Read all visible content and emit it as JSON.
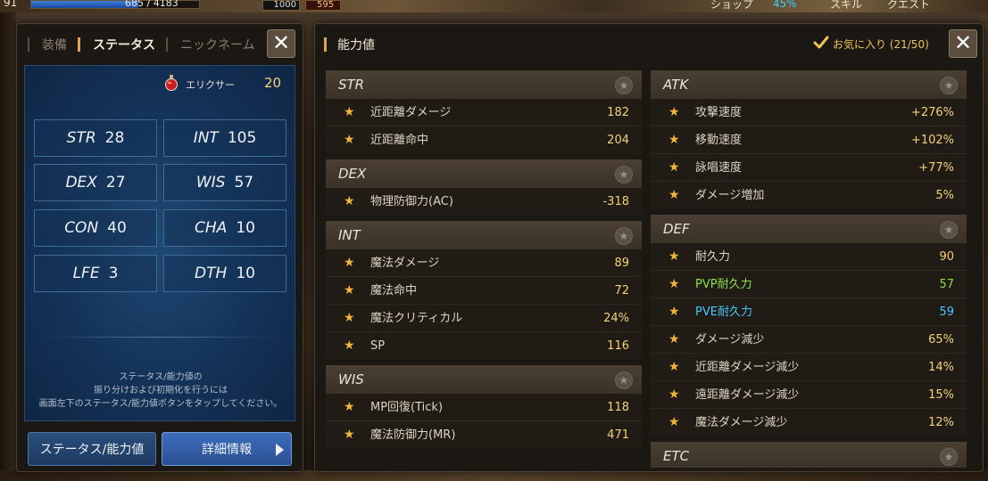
{
  "hud": {
    "level": "91",
    "hp_text": "685 / 4183",
    "hp_fraction": 0.64,
    "box1": "1000",
    "box2": "595",
    "menu": [
      "ショップ",
      "スキル",
      "クエスト"
    ],
    "percent": "45%"
  },
  "status_panel": {
    "tabs": [
      "装備",
      "ステータス",
      "ニックネーム"
    ],
    "active_tab": 1,
    "elixir": {
      "label": "エリクサー",
      "count": "20"
    },
    "stats": [
      {
        "name": "STR",
        "value": "28"
      },
      {
        "name": "INT",
        "value": "105"
      },
      {
        "name": "DEX",
        "value": "27"
      },
      {
        "name": "WIS",
        "value": "57"
      },
      {
        "name": "CON",
        "value": "40"
      },
      {
        "name": "CHA",
        "value": "10"
      },
      {
        "name": "LFE",
        "value": "3"
      },
      {
        "name": "DTH",
        "value": "10"
      }
    ],
    "hint_lines": [
      "ステータス/能力値の",
      "振り分けおよび初期化を行うには",
      "画面左下のステータス/能力値ボタンをタップしてください。"
    ],
    "buttons": {
      "status": "ステータス/能力値",
      "detail": "詳細情報"
    }
  },
  "ability_panel": {
    "title": "能力値",
    "favorite_label": "お気に入り (21/50)",
    "left_sections": [
      {
        "title": "STR",
        "rows": [
          {
            "label": "近距離ダメージ",
            "value": "182"
          },
          {
            "label": "近距離命中",
            "value": "204"
          }
        ]
      },
      {
        "title": "DEX",
        "rows": [
          {
            "label": "物理防御力(AC)",
            "value": "-318"
          }
        ]
      },
      {
        "title": "INT",
        "rows": [
          {
            "label": "魔法ダメージ",
            "value": "89"
          },
          {
            "label": "魔法命中",
            "value": "72"
          },
          {
            "label": "魔法クリティカル",
            "value": "24%"
          },
          {
            "label": "SP",
            "value": "116"
          }
        ]
      },
      {
        "title": "WIS",
        "rows": [
          {
            "label": "MP回復(Tick)",
            "value": "118"
          },
          {
            "label": "魔法防御力(MR)",
            "value": "471"
          }
        ]
      }
    ],
    "right_sections": [
      {
        "title": "ATK",
        "rows": [
          {
            "label": "攻撃速度",
            "value": "+276%"
          },
          {
            "label": "移動速度",
            "value": "+102%"
          },
          {
            "label": "詠唱速度",
            "value": "+77%"
          },
          {
            "label": "ダメージ増加",
            "value": "5%"
          }
        ]
      },
      {
        "title": "DEF",
        "rows": [
          {
            "label": "耐久力",
            "value": "90"
          },
          {
            "label": "PVP耐久力",
            "value": "57",
            "color": "green"
          },
          {
            "label": "PVE耐久力",
            "value": "59",
            "color": "cyan"
          },
          {
            "label": "ダメージ減少",
            "value": "65%"
          },
          {
            "label": "近距離ダメージ減少",
            "value": "14%"
          },
          {
            "label": "遠距離ダメージ減少",
            "value": "15%"
          },
          {
            "label": "魔法ダメージ減少",
            "value": "12%"
          }
        ]
      },
      {
        "title": "ETC",
        "rows": []
      }
    ]
  },
  "colors": {
    "accent_gold": "#f3d27a",
    "star": "#f1b53a",
    "pvp_green": "#8fe04c",
    "pve_cyan": "#45c8ff",
    "status_blue": "#143258"
  },
  "icons": {
    "row_marker": "star-icon",
    "section_favorite": "star-circle-icon",
    "close": "close-icon"
  }
}
